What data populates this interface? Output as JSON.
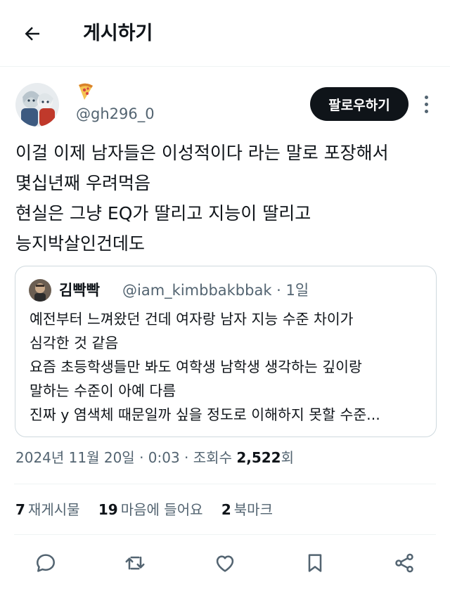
{
  "header": {
    "title": "게시하기",
    "back_icon": "arrow-left-icon"
  },
  "author": {
    "display_emoji": "🍕",
    "handle": "@gh296_0",
    "follow_label": "팔로우하기"
  },
  "tweet": {
    "lines": [
      "이걸 이제 남자들은 이성적이다 라는 말로 포장해서",
      "몇십년째 우려먹음",
      "현실은 그냥 EQ가 딸리고 지능이 딸리고",
      "능지박살인건데도"
    ]
  },
  "quote": {
    "name": "김빡빡",
    "handle_time": "@iam_kimbbakbbak · 1일",
    "lines": [
      "예전부터 느껴왔던 건데 여자랑 남자 지능 수준 차이가",
      "심각한 것 같음",
      "요즘 초등학생들만 봐도 여학생 남학생 생각하는 깊이랑",
      "말하는 수준이 아예 다름",
      "진짜 y 염색체 때문일까 싶을 정도로 이해하지 못할 수준..."
    ]
  },
  "meta": {
    "datetime": "2024년 11월 20일 · 0:03 · 조회수 ",
    "views": "2,522",
    "views_suffix": "회"
  },
  "stats": {
    "retweets_count": "7",
    "retweets_label": "재게시물",
    "likes_count": "19",
    "likes_label": "마음에 들어요",
    "bookmarks_count": "2",
    "bookmarks_label": "북마크"
  },
  "actions": [
    "reply-icon",
    "retweet-icon",
    "like-icon",
    "bookmark-icon",
    "share-icon"
  ],
  "colors": {
    "text": "#0f1419",
    "secondary": "#536471",
    "border": "#cfd9de",
    "divider": "#eff3f4",
    "button": "#0f1419"
  }
}
